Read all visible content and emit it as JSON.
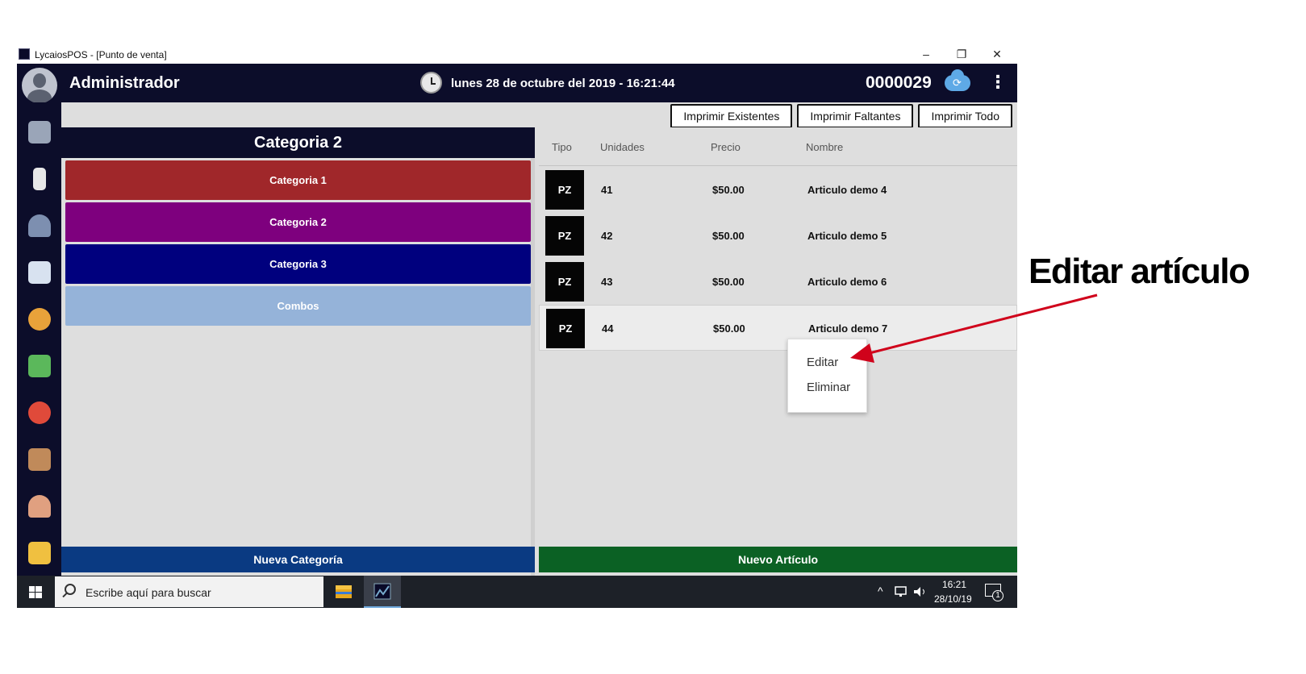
{
  "window": {
    "title": "LycaiosPOS - [Punto de venta]",
    "minimize": "–",
    "restore": "❐",
    "close": "✕"
  },
  "header": {
    "user": "Administrador",
    "datetime": "lunes 28 de octubre del 2019 - 16:21:44",
    "folio": "0000029",
    "menu_glyph": "⋮",
    "sync_glyph": "⟳"
  },
  "sidebar": {
    "items": [
      {
        "icon": "cart-icon",
        "color": "#9aa5b8"
      },
      {
        "icon": "receipt-icon",
        "color": "#e8e8e8"
      },
      {
        "icon": "users-icon",
        "color": "#7d8fb0"
      },
      {
        "icon": "report-clock-icon",
        "color": "#d8e2f0"
      },
      {
        "icon": "top-badge-icon",
        "color": "#e8a23a"
      },
      {
        "icon": "cash-icon",
        "color": "#5bb85b"
      },
      {
        "icon": "timer-icon",
        "color": "#e04a3a"
      },
      {
        "icon": "inventory-icon",
        "color": "#c08a5a"
      },
      {
        "icon": "employees-icon",
        "color": "#e0a080"
      },
      {
        "icon": "exit-icon",
        "color": "#f0c040"
      }
    ]
  },
  "toolbar": {
    "print_stock": "Imprimir Existentes",
    "print_missing": "Imprimir Faltantes",
    "print_all": "Imprimir Todo"
  },
  "categories": {
    "title": "Categoria 2",
    "items": [
      {
        "label": "Categoria 1",
        "color": "#a0272a"
      },
      {
        "label": "Categoria 2",
        "color": "#7e007e"
      },
      {
        "label": "Categoria 3",
        "color": "#00007e"
      },
      {
        "label": "Combos",
        "color": "#95b3d9"
      }
    ],
    "new_button": "Nueva Categoría"
  },
  "articles": {
    "columns": {
      "tipo": "Tipo",
      "unidades": "Unidades",
      "precio": "Precio",
      "nombre": "Nombre"
    },
    "rows": [
      {
        "tipo": "PZ",
        "unidades": "41",
        "precio": "$50.00",
        "nombre": "Articulo demo 4"
      },
      {
        "tipo": "PZ",
        "unidades": "42",
        "precio": "$50.00",
        "nombre": "Articulo demo 5"
      },
      {
        "tipo": "PZ",
        "unidades": "43",
        "precio": "$50.00",
        "nombre": "Articulo demo 6"
      },
      {
        "tipo": "PZ",
        "unidades": "44",
        "precio": "$50.00",
        "nombre": "Articulo demo 7"
      }
    ],
    "new_button": "Nuevo Artículo"
  },
  "context_menu": {
    "edit": "Editar",
    "delete": "Eliminar"
  },
  "annotation": {
    "text": "Editar artículo",
    "color": "#d0021b"
  },
  "taskbar": {
    "search_placeholder": "Escribe aquí para buscar",
    "time": "16:21",
    "date": "28/10/19",
    "notifications": "1"
  }
}
